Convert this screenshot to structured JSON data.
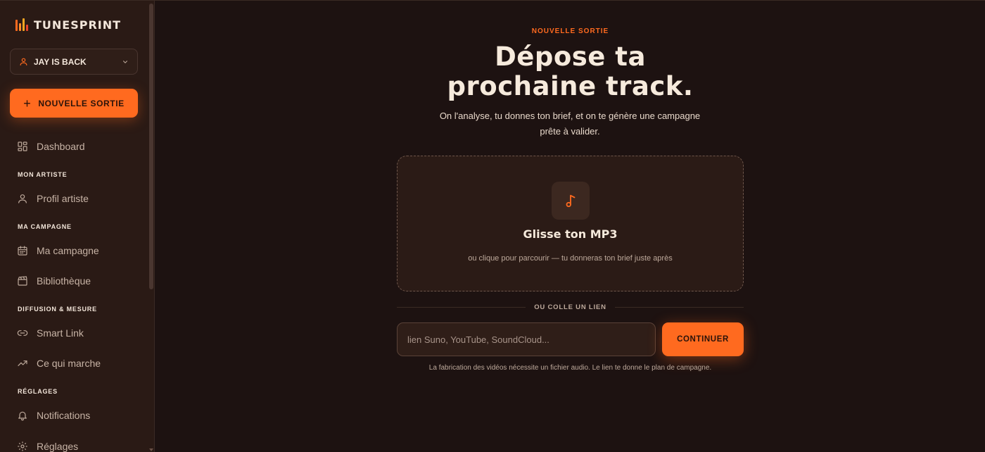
{
  "brand": {
    "name": "TUNESPRINT",
    "bar_colors": [
      "#ff6a1f",
      "#ff6a1f",
      "#f5a623",
      "#e8452c"
    ]
  },
  "sidebar": {
    "artist_select": {
      "value": "JAY IS BACK"
    },
    "new_release_label": "NOUVELLE SORTIE",
    "dashboard": "Dashboard",
    "sections": {
      "artist": "MON ARTISTE",
      "campaign": "MA CAMPAGNE",
      "diffusion": "DIFFUSION & MESURE",
      "settings": "RÉGLAGES"
    },
    "items": {
      "profile": "Profil artiste",
      "campaign": "Ma campagne",
      "library": "Bibliothèque",
      "smartlink": "Smart Link",
      "whatworks": "Ce qui marche",
      "notifications": "Notifications",
      "settings": "Réglages"
    }
  },
  "main": {
    "eyebrow": "NOUVELLE SORTIE",
    "headline_line1": "Dépose ta",
    "headline_line2": "prochaine track.",
    "subtitle": "On l'analyse, tu donnes ton brief, et on te génère une campagne prête à valider.",
    "dropzone": {
      "title": "Glisse ton MP3",
      "hint": "ou clique pour parcourir — tu donneras ton brief juste après"
    },
    "divider": "OU COLLE UN LIEN",
    "link_input": {
      "placeholder": "lien Suno, YouTube, SoundCloud...",
      "value": ""
    },
    "continue_label": "CONTINUER",
    "footnote": "La fabrication des vidéos nécessite un fichier audio. Le lien te donne le plan de campagne."
  },
  "colors": {
    "accent": "#ff6a1f",
    "background": "#1d1211",
    "sidebar": "#2a1a15"
  }
}
